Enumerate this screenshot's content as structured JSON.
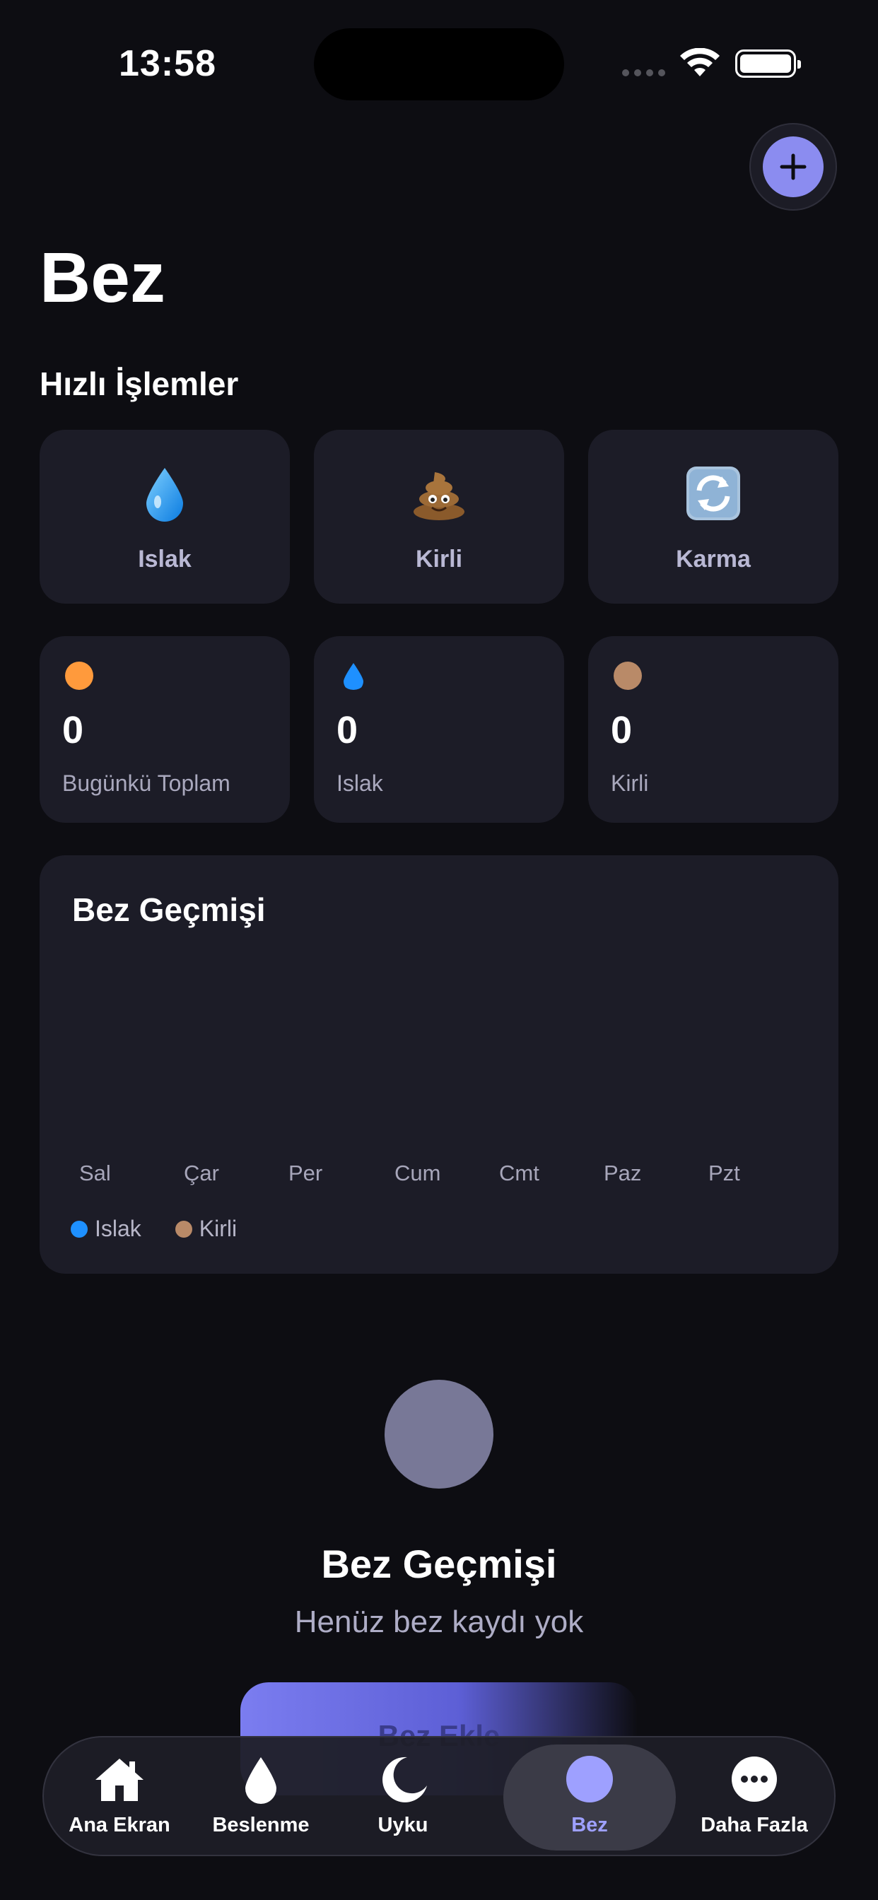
{
  "status_bar": {
    "time": "13:58"
  },
  "header": {
    "title": "Bez"
  },
  "quick_actions": {
    "title": "Hızlı İşlemler",
    "items": [
      {
        "label": "Islak",
        "icon": "water-drop-icon"
      },
      {
        "label": "Kirli",
        "icon": "poop-icon"
      },
      {
        "label": "Karma",
        "icon": "refresh-icon"
      }
    ]
  },
  "stats": [
    {
      "value": "0",
      "caption": "Bugünkü Toplam",
      "color": "#ff9a3c"
    },
    {
      "value": "0",
      "caption": "Islak",
      "color": "#1e90ff"
    },
    {
      "value": "0",
      "caption": "Kirli",
      "color": "#b98a68"
    }
  ],
  "history_chart": {
    "title": "Bez Geçmişi",
    "days": [
      "Sal",
      "Çar",
      "Per",
      "Cum",
      "Cmt",
      "Paz",
      "Pzt"
    ],
    "legend": [
      {
        "label": "Islak",
        "color": "#1e90ff"
      },
      {
        "label": "Kirli",
        "color": "#b98a68"
      }
    ]
  },
  "empty_state": {
    "title": "Bez Geçmişi",
    "subtitle": "Henüz bez kaydı yok",
    "button_label": "Bez Ekle"
  },
  "tabs": [
    {
      "label": "Ana Ekran",
      "icon": "house-icon"
    },
    {
      "label": "Beslenme",
      "icon": "drop-icon"
    },
    {
      "label": "Uyku",
      "icon": "moon-icon"
    },
    {
      "label": "Bez",
      "icon": "circle-icon",
      "active": true
    },
    {
      "label": "Daha Fazla",
      "icon": "more-icon"
    }
  ],
  "colors": {
    "accent": "#8b8cf0",
    "background": "#0d0d12",
    "card": "#1c1c27"
  }
}
